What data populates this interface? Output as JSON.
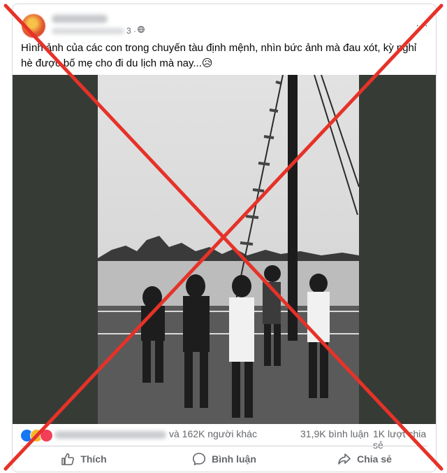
{
  "post": {
    "time_label": "3 ·",
    "caption": "Hình ảnh của các con trong chuyến tàu định mệnh, nhìn bức ảnh mà đau xót, kỳ nghỉ hè được bố mẹ cho đi du lịch mà nay...😥",
    "more_label": "···"
  },
  "reactions": {
    "icons": [
      "like-icon",
      "care-icon",
      "haha-icon"
    ],
    "others_text": "và 162K người khác",
    "comments_text": "31,9K bình luận",
    "shares_text": "1K lượt chia sẻ"
  },
  "actions": {
    "like_label": "Thích",
    "comment_label": "Bình luận",
    "share_label": "Chia sẻ"
  },
  "colors": {
    "cross_red": "#e63228",
    "media_bg": "#373b36",
    "action_gray": "#65676b"
  }
}
